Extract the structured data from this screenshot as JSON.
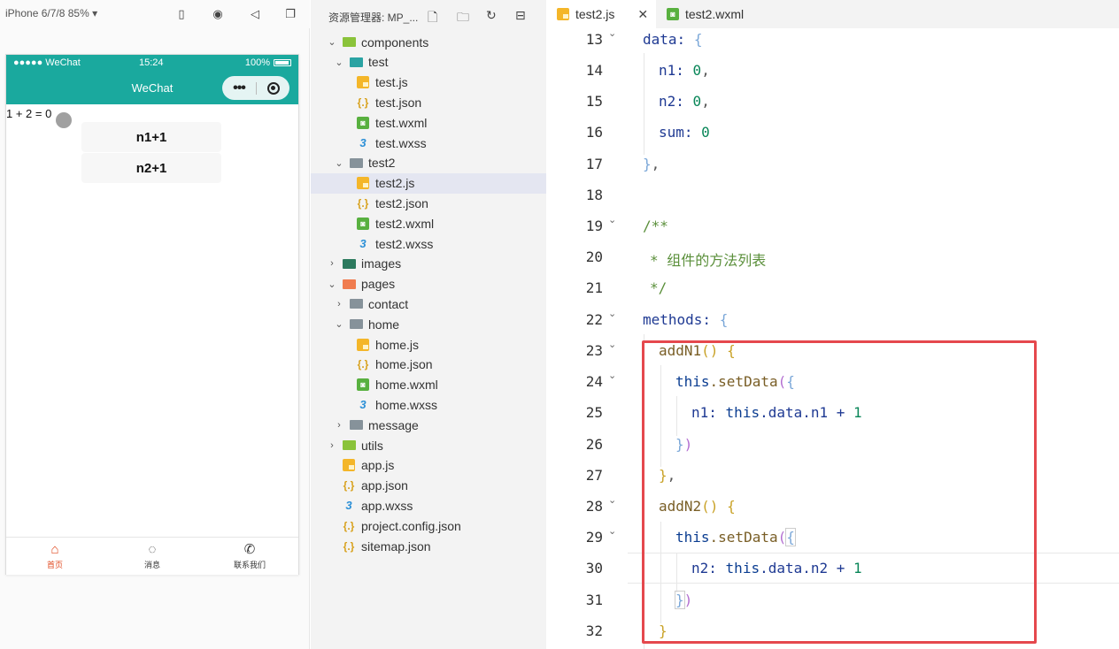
{
  "simulator": {
    "device_label": "iPhone 6/7/8 85% ▾",
    "status_signal": "●●●●● WeChat",
    "status_time": "15:24",
    "status_battery": "100%",
    "nav_title": "WeChat",
    "capsule_dots": "•••",
    "equation": "1 + 2 = 0",
    "buttons": [
      "n1+1",
      "n2+1"
    ],
    "tabbar": [
      {
        "label": "首页",
        "icon": "home-icon"
      },
      {
        "label": "消息",
        "icon": "message-icon"
      },
      {
        "label": "联系我们",
        "icon": "phone-icon"
      }
    ]
  },
  "explorer": {
    "title": "资源管理器: MP_...",
    "items": [
      {
        "label": "components",
        "type": "folder",
        "color": "green",
        "indent": 1,
        "open": true
      },
      {
        "label": "test",
        "type": "folder",
        "color": "teal",
        "indent": 2,
        "open": true
      },
      {
        "label": "test.js",
        "type": "js",
        "indent": 3
      },
      {
        "label": "test.json",
        "type": "json",
        "indent": 3
      },
      {
        "label": "test.wxml",
        "type": "wxml",
        "indent": 3
      },
      {
        "label": "test.wxss",
        "type": "wxss",
        "indent": 3
      },
      {
        "label": "test2",
        "type": "folder",
        "color": "grey",
        "indent": 2,
        "open": true
      },
      {
        "label": "test2.js",
        "type": "js",
        "indent": 3,
        "selected": true
      },
      {
        "label": "test2.json",
        "type": "json",
        "indent": 3
      },
      {
        "label": "test2.wxml",
        "type": "wxml",
        "indent": 3
      },
      {
        "label": "test2.wxss",
        "type": "wxss",
        "indent": 3
      },
      {
        "label": "images",
        "type": "folder",
        "color": "dark",
        "indent": 1,
        "open": false
      },
      {
        "label": "pages",
        "type": "folder",
        "color": "orange",
        "indent": 1,
        "open": true
      },
      {
        "label": "contact",
        "type": "folder",
        "color": "grey",
        "indent": 2,
        "open": false
      },
      {
        "label": "home",
        "type": "folder",
        "color": "grey",
        "indent": 2,
        "open": true
      },
      {
        "label": "home.js",
        "type": "js",
        "indent": 3
      },
      {
        "label": "home.json",
        "type": "json",
        "indent": 3
      },
      {
        "label": "home.wxml",
        "type": "wxml",
        "indent": 3
      },
      {
        "label": "home.wxss",
        "type": "wxss",
        "indent": 3
      },
      {
        "label": "message",
        "type": "folder",
        "color": "grey",
        "indent": 2,
        "open": false
      },
      {
        "label": "utils",
        "type": "folder",
        "color": "green",
        "indent": 1,
        "open": false
      },
      {
        "label": "app.js",
        "type": "js",
        "indent": 1
      },
      {
        "label": "app.json",
        "type": "json",
        "indent": 1
      },
      {
        "label": "app.wxss",
        "type": "wxss",
        "indent": 1
      },
      {
        "label": "project.config.json",
        "type": "json",
        "indent": 1
      },
      {
        "label": "sitemap.json",
        "type": "json",
        "indent": 1
      }
    ]
  },
  "editor": {
    "tabs": [
      {
        "label": "test2.js",
        "type": "js",
        "active": true,
        "close": "✕"
      },
      {
        "label": "test2.wxml",
        "type": "wxml",
        "active": false
      }
    ],
    "line_numbers": [
      "13",
      "14",
      "15",
      "16",
      "17",
      "18",
      "19",
      "20",
      "21",
      "22",
      "23",
      "24",
      "25",
      "26",
      "27",
      "28",
      "29",
      "30",
      "31",
      "32"
    ],
    "code": {
      "l13": "data:",
      "l14a": "n1:",
      "l14b": "0",
      "l15a": "n2:",
      "l15b": "0",
      "l16a": "sum:",
      "l16b": "0",
      "l19": "/**",
      "l20": "* 组件的方法列表",
      "l21": "*/",
      "l22": "methods:",
      "l23": "addN1",
      "l24a": "this",
      "l24b": ".setData",
      "l25a": "n1:",
      "l25b": "this",
      "l25c": ".data.n1 + ",
      "l25d": "1",
      "l28": "addN2",
      "l29a": "this",
      "l29b": ".setData",
      "l30a": "n2:",
      "l30b": "this",
      "l30c": ".data.n2 + ",
      "l30d": "1"
    }
  }
}
